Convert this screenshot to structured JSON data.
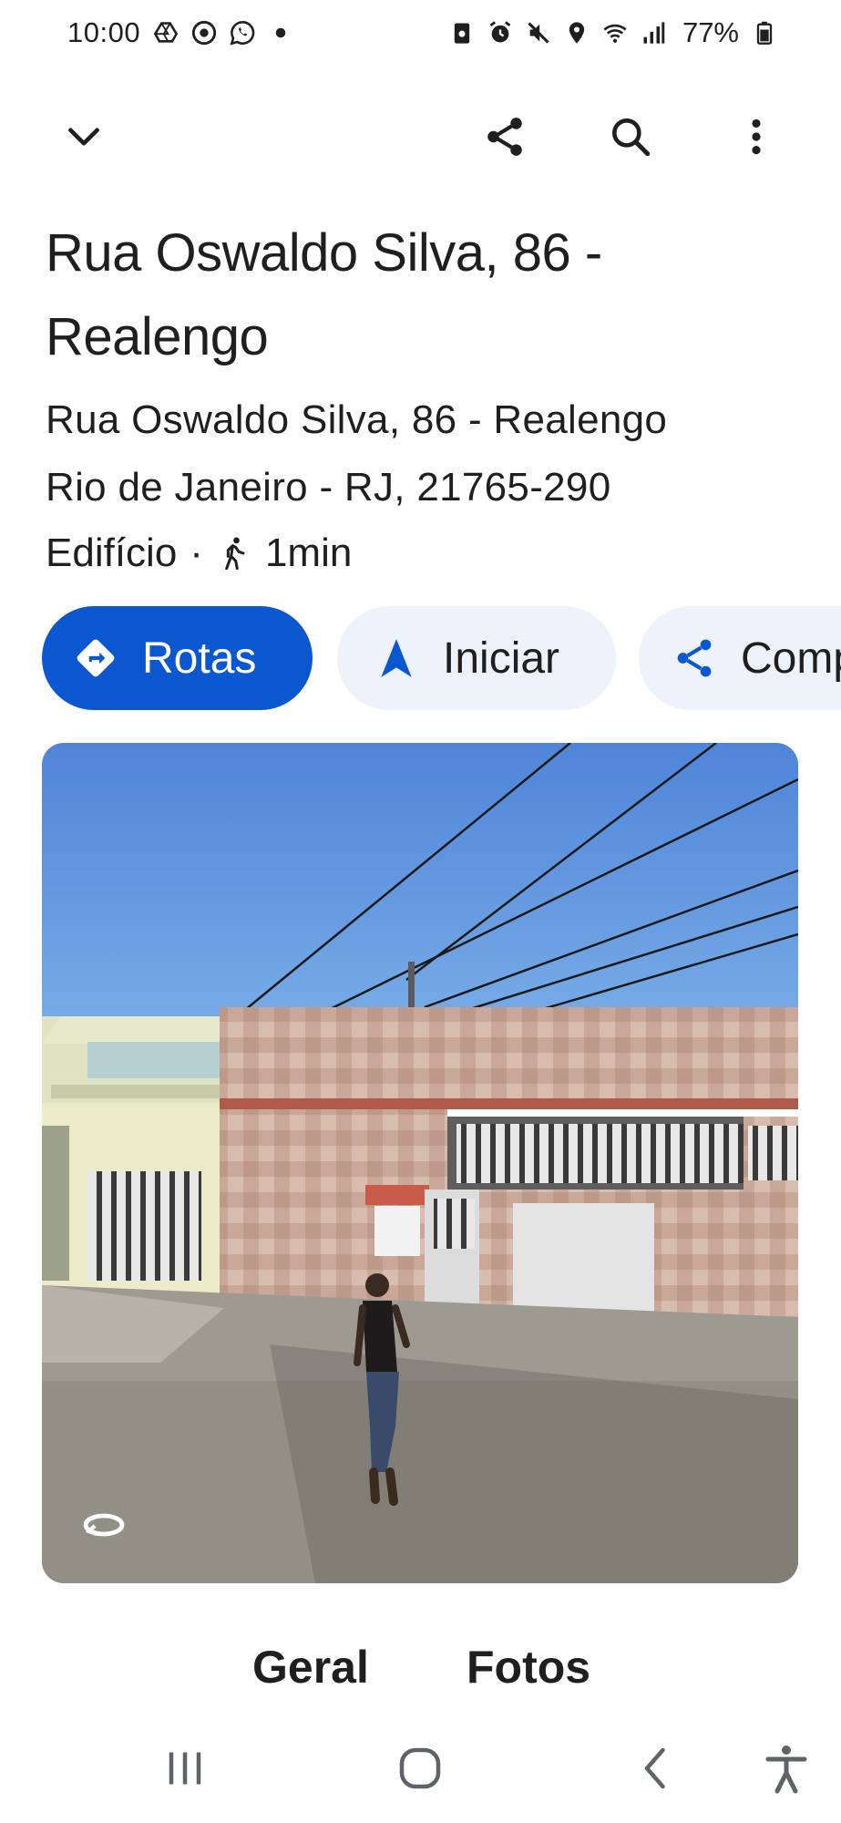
{
  "status_bar": {
    "time": "10:00",
    "left_icons": [
      "drive-icon",
      "chrome-icon",
      "whatsapp-icon",
      "dot-icon"
    ],
    "right_icons": [
      "lock-icon",
      "alarm-icon",
      "mute-icon",
      "location-icon",
      "wifi-icon",
      "signal-icon"
    ],
    "battery": "77%"
  },
  "app_bar": {
    "icons": [
      "chevron-down-icon",
      "share-icon",
      "search-icon",
      "more-vert-icon"
    ]
  },
  "place": {
    "title": "Rua Oswaldo Silva, 86 - Realengo",
    "address_line1": "Rua Oswaldo Silva, 86 - Realengo",
    "address_line2": "Rio de Janeiro - RJ, 21765-290",
    "category": "Edifício",
    "separator": "·",
    "walk_time": "1min"
  },
  "actions": {
    "routes": "Rotas",
    "start": "Iniciar",
    "share": "Compartilhar"
  },
  "colors": {
    "primary": "#0b57d0",
    "chip_bg": "#eef2fb",
    "text": "#1f1f1f"
  },
  "tabs": [
    "Geral",
    "Fotos"
  ],
  "nav_bar": {
    "icons": [
      "recents-icon",
      "home-icon",
      "back-icon",
      "accessibility-icon"
    ]
  }
}
